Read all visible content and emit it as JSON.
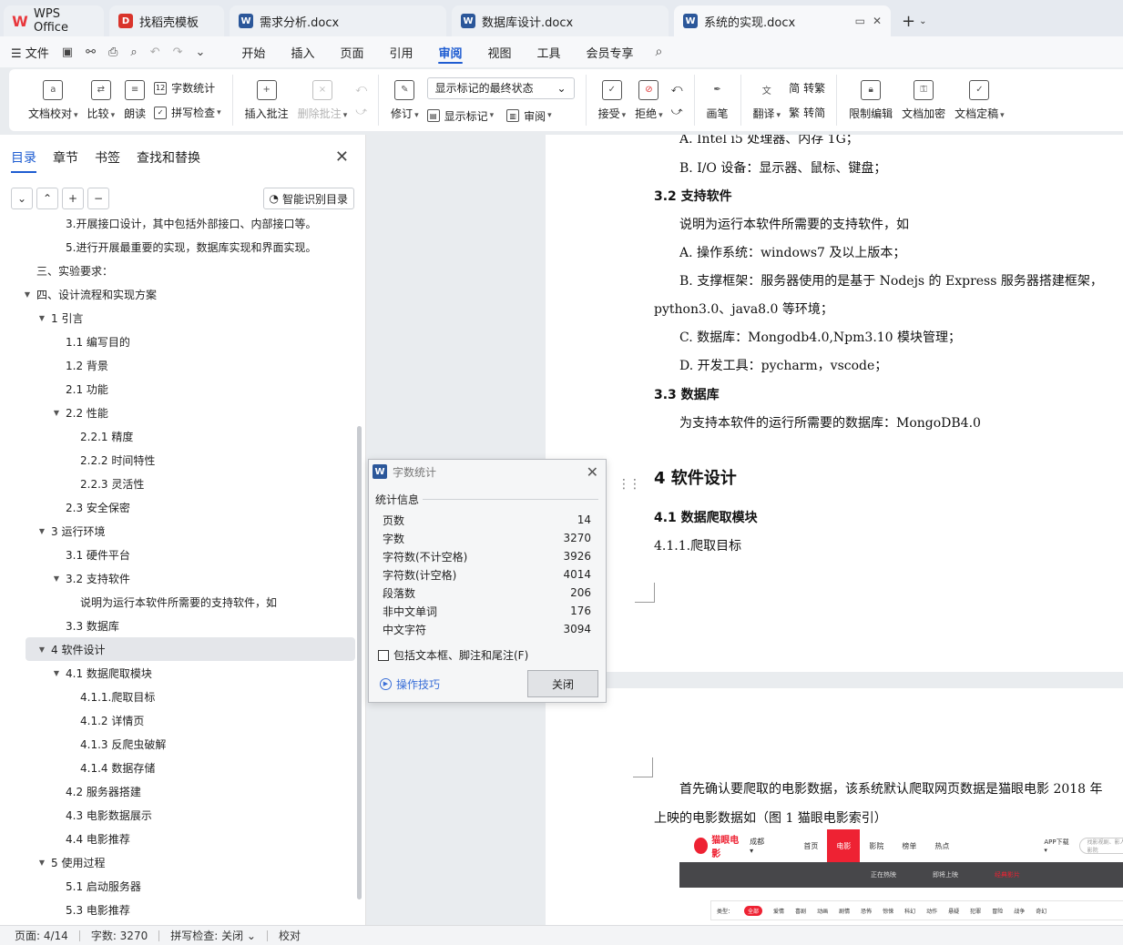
{
  "tabs": [
    {
      "label": "WPS Office",
      "icon": "wps-logo-icon"
    },
    {
      "label": "找稻壳模板",
      "icon": "daoke-icon"
    },
    {
      "label": "需求分析.docx",
      "icon": "word-doc-icon"
    },
    {
      "label": "数据库设计.docx",
      "icon": "word-doc-icon"
    },
    {
      "label": "系统的实现.docx",
      "icon": "word-doc-icon"
    }
  ],
  "menu": {
    "file": "文件",
    "tabs": [
      "开始",
      "插入",
      "页面",
      "引用",
      "审阅",
      "视图",
      "工具",
      "会员专享"
    ],
    "active": "审阅"
  },
  "ribbon": {
    "doc_check": "文档校对",
    "compare": "比较",
    "read_aloud": "朗读",
    "word_count": "字数统计",
    "spell_check": "拼写检查",
    "insert_comment": "插入批注",
    "delete_comment": "删除批注",
    "revise": "修订",
    "markup_view": "显示标记的最终状态",
    "show_markup": "显示标记",
    "review": "审阅",
    "accept": "接受",
    "reject": "拒绝",
    "pen": "画笔",
    "translate": "翻译",
    "to_traditional": "转繁",
    "to_simplified": "转简",
    "restrict_edit": "限制编辑",
    "doc_encrypt": "文档加密",
    "doc_finalize": "文档定稿"
  },
  "nav": {
    "tabs": [
      "目录",
      "章节",
      "书签",
      "查找和替换"
    ],
    "active": "目录",
    "smart_toc": "智能识别目录",
    "toc": [
      {
        "text": "3.开展接口设计，其中包括外部接口、内部接口等。",
        "level": 3,
        "arrow": ""
      },
      {
        "text": "5.进行开展最重要的实现，数据库实现和界面实现。",
        "level": 3,
        "arrow": ""
      },
      {
        "text": "三、实验要求：",
        "level": 1,
        "arrow": ""
      },
      {
        "text": "四、设计流程和实现方案",
        "level": 0,
        "arrow": "▼"
      },
      {
        "text": "1 引言",
        "level": 1,
        "arrow": "▼"
      },
      {
        "text": "1.1 编写目的",
        "level": 3,
        "arrow": ""
      },
      {
        "text": "1.2 背景",
        "level": 3,
        "arrow": ""
      },
      {
        "text": "2.1 功能",
        "level": 3,
        "arrow": ""
      },
      {
        "text": "2.2 性能",
        "level": 2,
        "arrow": "▼"
      },
      {
        "text": "2.2.1 精度",
        "level": 4,
        "arrow": ""
      },
      {
        "text": "2.2.2 时间特性",
        "level": 4,
        "arrow": ""
      },
      {
        "text": "2.2.3 灵活性",
        "level": 4,
        "arrow": ""
      },
      {
        "text": "2.3 安全保密",
        "level": 3,
        "arrow": ""
      },
      {
        "text": "3 运行环境",
        "level": 1,
        "arrow": "▼"
      },
      {
        "text": "3.1 硬件平台",
        "level": 3,
        "arrow": ""
      },
      {
        "text": "3.2 支持软件",
        "level": 2,
        "arrow": "▼"
      },
      {
        "text": "说明为运行本软件所需要的支持软件，如",
        "level": 4,
        "arrow": ""
      },
      {
        "text": "3.3 数据库",
        "level": 3,
        "arrow": ""
      },
      {
        "text": "4 软件设计",
        "level": 1,
        "arrow": "▼",
        "selected": true
      },
      {
        "text": "4.1 数据爬取模块",
        "level": 2,
        "arrow": "▼"
      },
      {
        "text": "4.1.1.爬取目标",
        "level": 4,
        "arrow": ""
      },
      {
        "text": "4.1.2 详情页",
        "level": 4,
        "arrow": ""
      },
      {
        "text": "4.1.3 反爬虫破解",
        "level": 4,
        "arrow": ""
      },
      {
        "text": "4.1.4 数据存储",
        "level": 4,
        "arrow": ""
      },
      {
        "text": "4.2 服务器搭建",
        "level": 3,
        "arrow": ""
      },
      {
        "text": "4.3 电影数据展示",
        "level": 3,
        "arrow": ""
      },
      {
        "text": "4.4 电影推荐",
        "level": 3,
        "arrow": ""
      },
      {
        "text": "5 使用过程",
        "level": 1,
        "arrow": "▼"
      },
      {
        "text": "5.1 启动服务器",
        "level": 3,
        "arrow": ""
      },
      {
        "text": "5.3 电影推荐",
        "level": 3,
        "arrow": ""
      }
    ]
  },
  "doc": {
    "page1_lines": [
      {
        "text": "A.  Intel i5 处理器、内存 1G；",
        "kind": "body",
        "indent": true
      },
      {
        "text": "B.  I/O 设备：显示器、鼠标、键盘；",
        "kind": "body",
        "indent": true
      },
      {
        "text": "3.2 支持软件",
        "kind": "h",
        "indent": false
      },
      {
        "text": "说明为运行本软件所需要的支持软件，如",
        "kind": "body",
        "indent": true
      },
      {
        "text": "A.  操作系统：windows7 及以上版本；",
        "kind": "body",
        "indent": true
      },
      {
        "text": "B.  支撑框架：服务器使用的是基于 Nodejs  的 Express 服务器搭建框架，",
        "kind": "body",
        "indent": true
      },
      {
        "text": "python3.0、java8.0  等环境；",
        "kind": "body",
        "indent": false
      },
      {
        "text": "C.  数据库：Mongodb4.0,Npm3.10  模块管理；",
        "kind": "body",
        "indent": true
      },
      {
        "text": "D.  开发工具：pycharm，vscode；",
        "kind": "body",
        "indent": true
      },
      {
        "text": "3.3  数据库",
        "kind": "h",
        "indent": false
      },
      {
        "text": "为支持本软件的运行所需要的数据库：MongoDB4.0",
        "kind": "body",
        "indent": true
      },
      {
        "text": "4  软件设计",
        "kind": "h1",
        "indent": false
      },
      {
        "text": "4.1  数据爬取模块",
        "kind": "h",
        "indent": false
      },
      {
        "text": "4.1.1.爬取目标",
        "kind": "body",
        "indent": false
      }
    ],
    "page2_lines": [
      {
        "text": "首先确认要爬取的电影数据，该系统默认爬取网页数据是猫眼电影 2018 年",
        "indent": true
      },
      {
        "text": "上映的电影数据如（图 1  猫眼电影索引）",
        "indent": false
      }
    ],
    "maoyan": {
      "logo": "猫眼电影",
      "city": "成都 ▾",
      "nav": [
        "首页",
        "电影",
        "影院",
        "榜单",
        "热点"
      ],
      "nav_active": "电影",
      "app": "APP下载 ▾",
      "search_placeholder": "找影视剧、影人、影院",
      "sub": [
        "正在热映",
        "即将上映",
        "经典影片"
      ],
      "sub_active": "经典影片",
      "filter_label": "类型：",
      "filters": [
        "全部",
        "爱情",
        "喜剧",
        "动画",
        "剧情",
        "恐怖",
        "惊悚",
        "科幻",
        "动作",
        "悬疑",
        "犯罪",
        "冒险",
        "战争",
        "奇幻"
      ],
      "filter_active": "全部"
    }
  },
  "word_count_dialog": {
    "title": "字数统计",
    "section": "统计信息",
    "stats": [
      {
        "label": "页数",
        "value": "14"
      },
      {
        "label": "字数",
        "value": "3270"
      },
      {
        "label": "字符数(不计空格)",
        "value": "3926"
      },
      {
        "label": "字符数(计空格)",
        "value": "4014"
      },
      {
        "label": "段落数",
        "value": "206"
      },
      {
        "label": "非中文单词",
        "value": "176"
      },
      {
        "label": "中文字符",
        "value": "3094"
      }
    ],
    "checkbox": "包括文本框、脚注和尾注(F)",
    "tips": "操作技巧",
    "close": "关闭"
  },
  "status": {
    "page": "页面: 4/14",
    "words": "字数: 3270",
    "spell": "拼写检查: 关闭 ⌄",
    "proof": "校对"
  }
}
